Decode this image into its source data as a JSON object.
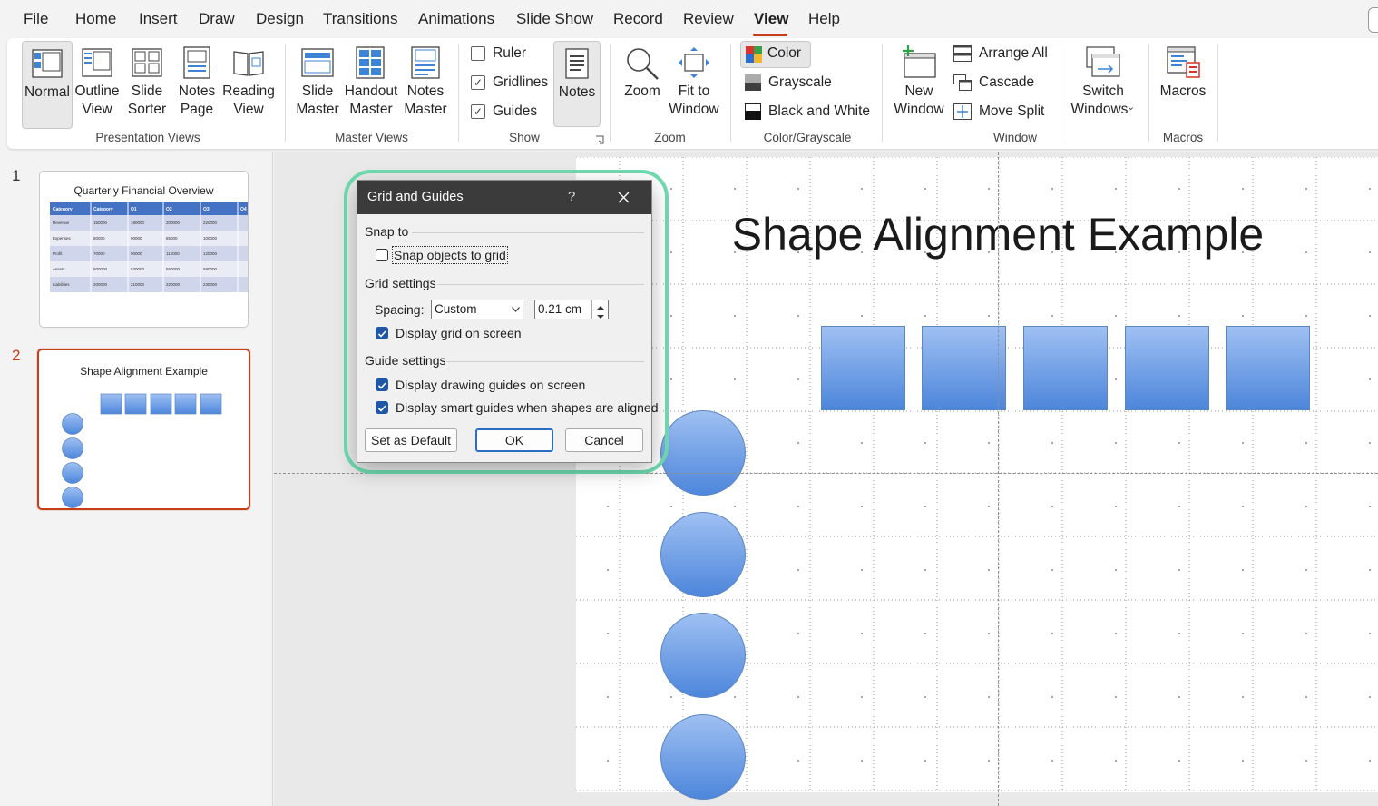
{
  "menu": {
    "items": [
      "File",
      "Home",
      "Insert",
      "Draw",
      "Design",
      "Transitions",
      "Animations",
      "Slide Show",
      "Record",
      "Review",
      "View",
      "Help"
    ],
    "active": "View"
  },
  "ribbon": {
    "presentation_views": {
      "label": "Presentation Views",
      "normal": "Normal",
      "outline_line1": "Outline",
      "outline_line2": "View",
      "sorter_line1": "Slide",
      "sorter_line2": "Sorter",
      "notes_page_line1": "Notes",
      "notes_page_line2": "Page",
      "reading_line1": "Reading",
      "reading_line2": "View"
    },
    "master_views": {
      "label": "Master Views",
      "slide_line1": "Slide",
      "slide_line2": "Master",
      "handout_line1": "Handout",
      "handout_line2": "Master",
      "notes_line1": "Notes",
      "notes_line2": "Master"
    },
    "show": {
      "label": "Show",
      "ruler": "Ruler",
      "ruler_checked": false,
      "gridlines": "Gridlines",
      "gridlines_checked": true,
      "guides": "Guides",
      "guides_checked": true,
      "notes": "Notes"
    },
    "zoom": {
      "label": "Zoom",
      "zoom": "Zoom",
      "fit_line1": "Fit to",
      "fit_line2": "Window"
    },
    "color_grayscale": {
      "label": "Color/Grayscale",
      "color": "Color",
      "grayscale": "Grayscale",
      "bw": "Black and White"
    },
    "window": {
      "label": "Window",
      "new_line1": "New",
      "new_line2": "Window",
      "arrange_all": "Arrange All",
      "cascade": "Cascade",
      "move_split": "Move Split",
      "switch_line1": "Switch",
      "switch_line2": "Windows"
    },
    "macros": {
      "label": "Macros",
      "macros": "Macros"
    }
  },
  "thumbnails": [
    {
      "number": "1",
      "title": "Quarterly Financial Overview",
      "table_header": [
        "Category",
        "Category",
        "Q1",
        "Q2",
        "Q3",
        "Q4"
      ],
      "table_rows": [
        [
          "Revenue",
          "150000",
          "180000",
          "200000",
          "220000"
        ],
        [
          "Expenses",
          "80000",
          "90000",
          "85000",
          "100000"
        ],
        [
          "Profit",
          "70000",
          "90000",
          "115000",
          "120000"
        ],
        [
          "Assets",
          "500000",
          "520000",
          "550000",
          "580000"
        ],
        [
          "Liabilities",
          "200000",
          "210000",
          "220000",
          "230000"
        ]
      ]
    },
    {
      "number": "2",
      "title": "Shape Alignment Example"
    }
  ],
  "slide": {
    "title": "Shape Alignment Example"
  },
  "dialog": {
    "title": "Grid and Guides",
    "help": "?",
    "snap_section": "Snap to",
    "snap_objects": "Snap objects to grid",
    "snap_objects_checked": false,
    "grid_section": "Grid settings",
    "spacing_label": "Spacing:",
    "spacing_select": "Custom",
    "spacing_value": "0.21 cm",
    "display_grid": "Display grid on screen",
    "display_grid_checked": true,
    "guide_section": "Guide settings",
    "display_guides": "Display drawing guides on screen",
    "display_guides_checked": true,
    "smart_guides": "Display smart guides when shapes are aligned",
    "smart_guides_checked": true,
    "set_default": "Set as Default",
    "ok": "OK",
    "cancel": "Cancel"
  },
  "colors": {
    "accent": "#c43e1c",
    "highlight_outline": "#6fdcb0",
    "shape_fill_top": "#9fc0f2",
    "shape_fill_bottom": "#4d86db",
    "dialog_title_bg": "#3b3b3b"
  }
}
